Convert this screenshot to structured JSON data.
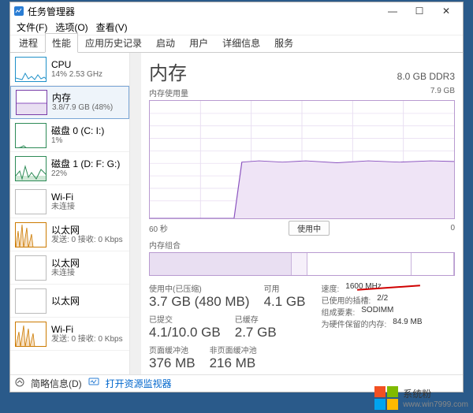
{
  "window": {
    "title": "任务管理器",
    "min": "—",
    "max": "☐",
    "close": "✕"
  },
  "menu": {
    "file": "文件(F)",
    "options": "选项(O)",
    "view": "查看(V)"
  },
  "tabs": {
    "processes": "进程",
    "performance": "性能",
    "history": "应用历史记录",
    "startup": "启动",
    "users": "用户",
    "details": "详细信息",
    "services": "服务"
  },
  "sidebar": {
    "items": [
      {
        "title": "CPU",
        "sub": "14% 2.53 GHz"
      },
      {
        "title": "内存",
        "sub": "3.8/7.9 GB (48%)"
      },
      {
        "title": "磁盘 0 (C: I:)",
        "sub": "1%"
      },
      {
        "title": "磁盘 1 (D: F: G:)",
        "sub": "22%"
      },
      {
        "title": "Wi-Fi",
        "sub": "未连接"
      },
      {
        "title": "以太网",
        "sub": "发送: 0 接收: 0 Kbps"
      },
      {
        "title": "以太网",
        "sub": "未连接"
      },
      {
        "title": "以太网",
        "sub": ""
      },
      {
        "title": "Wi-Fi",
        "sub": "发送: 0 接收: 0 Kbps"
      }
    ]
  },
  "main": {
    "title": "内存",
    "right_header": "8.0 GB DDR3",
    "usage_label": "内存使用量",
    "usage_max": "7.9 GB",
    "x_left": "60 秒",
    "x_right": "0",
    "pill": "使用中",
    "slots_label": "内存组合"
  },
  "stats": {
    "inuse": {
      "label": "使用中(已压缩)",
      "value": "3.7 GB (480 MB)"
    },
    "avail": {
      "label": "可用",
      "value": "4.1 GB"
    },
    "commit": {
      "label": "已提交",
      "value": "4.1/10.0 GB"
    },
    "cached": {
      "label": "已缓存",
      "value": "2.7 GB"
    },
    "paged": {
      "label": "页面缓冲池",
      "value": "376 MB"
    },
    "nonpaged": {
      "label": "非页面缓冲池",
      "value": "216 MB"
    }
  },
  "kv": {
    "speed": {
      "label": "速度:",
      "value": "1600 MHz"
    },
    "slots": {
      "label": "已使用的插槽:",
      "value": "2/2"
    },
    "form": {
      "label": "组成要素:",
      "value": "SODIMM"
    },
    "hw": {
      "label": "为硬件保留的内存:",
      "value": "84.9 MB"
    }
  },
  "footer": {
    "less": "简略信息(D)",
    "link": "打开资源监视器"
  },
  "watermark": {
    "main": "系统粉",
    "sub": "www.win7999.com"
  },
  "chart_data": {
    "type": "area",
    "title": "内存使用量",
    "ylabel": "GB",
    "ylim": [
      0,
      7.9
    ],
    "xlabel": "60 秒 → 0",
    "x": [
      60,
      55,
      50,
      45,
      42,
      41,
      40,
      35,
      30,
      25,
      20,
      15,
      10,
      5,
      0
    ],
    "values": [
      0,
      0,
      0,
      0,
      0,
      0.3,
      3.8,
      3.8,
      3.85,
      3.8,
      3.8,
      3.75,
      3.8,
      3.8,
      3.8
    ]
  }
}
